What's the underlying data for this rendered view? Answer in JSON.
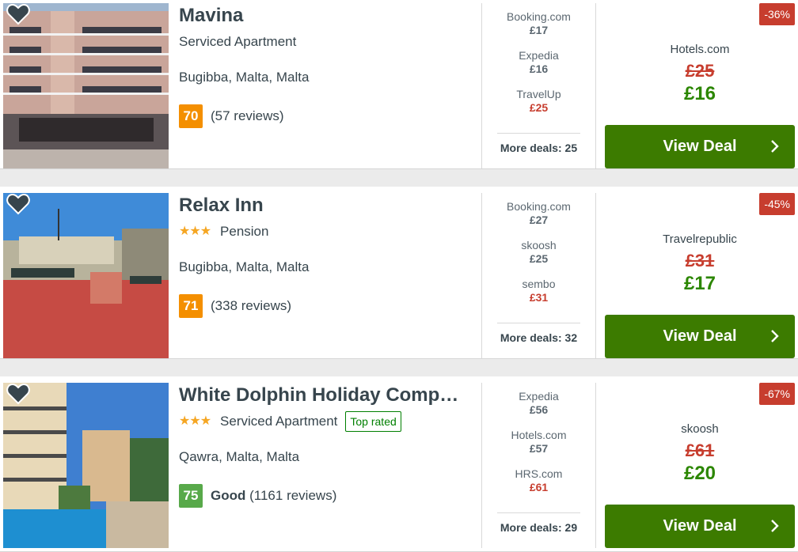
{
  "hotels": [
    {
      "name": "Mavina",
      "stars": "",
      "type": "Serviced Apartment",
      "top_rated": "",
      "location": "Bugibba, Malta, Malta",
      "score": "70",
      "rating_word": "",
      "reviews": "(57 reviews)",
      "deals": [
        {
          "provider": "Booking.com",
          "price": "£17"
        },
        {
          "provider": "Expedia",
          "price": "£16"
        },
        {
          "provider": "TravelUp",
          "price": "£25"
        }
      ],
      "more_deals": "More deals: 25",
      "discount": "-36%",
      "best_provider": "Hotels.com",
      "old_price": "£25",
      "new_price": "£16",
      "cta": "View Deal"
    },
    {
      "name": "Relax Inn",
      "stars": "★★★",
      "type": "Pension",
      "top_rated": "",
      "location": "Bugibba, Malta, Malta",
      "score": "71",
      "rating_word": "",
      "reviews": "(338 reviews)",
      "deals": [
        {
          "provider": "Booking.com",
          "price": "£27"
        },
        {
          "provider": "skoosh",
          "price": "£25"
        },
        {
          "provider": "sembo",
          "price": "£31"
        }
      ],
      "more_deals": "More deals: 32",
      "discount": "-45%",
      "best_provider": "Travelrepublic",
      "old_price": "£31",
      "new_price": "£17",
      "cta": "View Deal"
    },
    {
      "name": "White Dolphin Holiday Comp…",
      "stars": "★★★",
      "type": "Serviced Apartment",
      "top_rated": "Top rated",
      "location": "Qawra, Malta, Malta",
      "score": "75",
      "rating_word": "Good",
      "reviews": "(1161 reviews)",
      "deals": [
        {
          "provider": "Expedia",
          "price": "£56"
        },
        {
          "provider": "Hotels.com",
          "price": "£57"
        },
        {
          "provider": "HRS.com",
          "price": "£61"
        }
      ],
      "more_deals": "More deals: 29",
      "discount": "-67%",
      "best_provider": "skoosh",
      "old_price": "£61",
      "new_price": "£20",
      "cta": "View Deal"
    }
  ],
  "colors": {
    "cta_green": "#3c7b00",
    "price_green": "#2b8600",
    "discount_red": "#c73d2e",
    "score_orange": "#f48f00",
    "score_green": "#58a94a",
    "star_gold": "#f5a623"
  },
  "icons": [
    "heart-icon",
    "chevron-right-icon",
    "star-icon"
  ]
}
